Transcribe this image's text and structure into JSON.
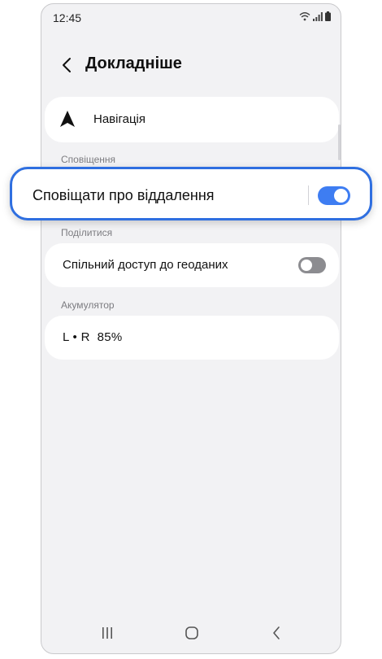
{
  "status_bar": {
    "time": "12:45"
  },
  "header": {
    "title": "Докладніше"
  },
  "navigation_item": {
    "label": "Навігація"
  },
  "notifications_section": {
    "label": "Сповіщення",
    "toggle_item": {
      "label": "Сповіщати про віддалення",
      "enabled": true
    }
  },
  "share_section": {
    "label": "Поділитися",
    "toggle_item": {
      "label": "Спільний доступ до геоданих",
      "enabled": false
    }
  },
  "battery_section": {
    "label": "Акумулятор",
    "value": "L • R  85%"
  },
  "colors": {
    "accent": "#2f6fe0",
    "toggle_on": "#3e7df2",
    "toggle_off": "#8c8c90",
    "background": "#f2f2f4"
  },
  "icons": [
    "back-icon",
    "navigation-arrow-icon",
    "wifi-icon",
    "signal-icon",
    "battery-icon",
    "recent-apps-icon",
    "home-icon",
    "back-nav-icon"
  ]
}
